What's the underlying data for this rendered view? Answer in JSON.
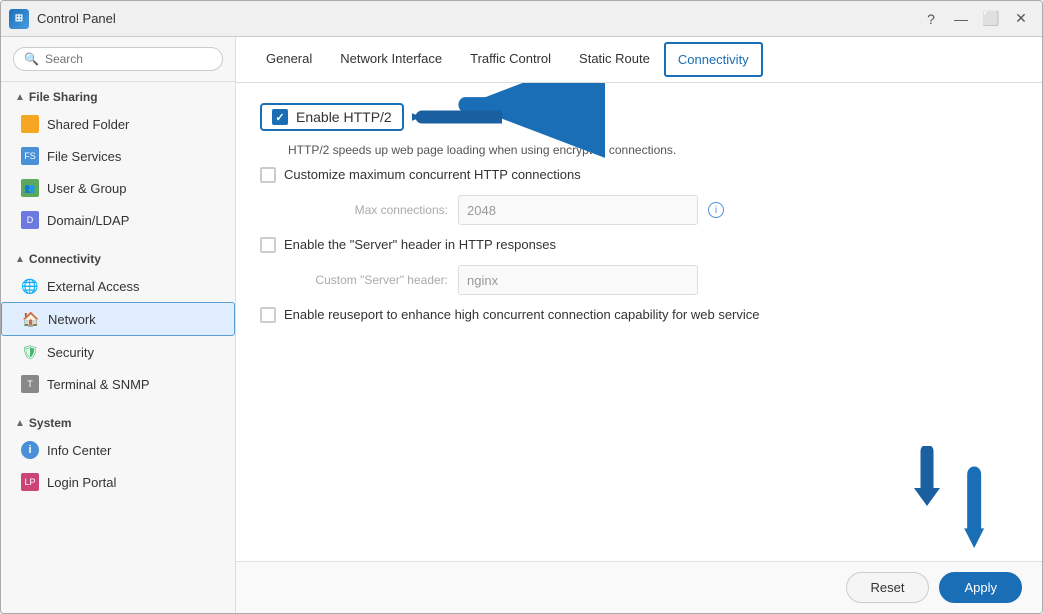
{
  "window": {
    "title": "Control Panel",
    "controls": [
      "?",
      "—",
      "⬜",
      "✕"
    ]
  },
  "sidebar": {
    "search_placeholder": "Search",
    "sections": [
      {
        "name": "file-sharing",
        "label": "File Sharing",
        "expanded": true,
        "items": [
          {
            "id": "shared-folder",
            "label": "Shared Folder",
            "icon": "folder"
          },
          {
            "id": "file-services",
            "label": "File Services",
            "icon": "file"
          },
          {
            "id": "user-group",
            "label": "User & Group",
            "icon": "user"
          },
          {
            "id": "domain-ldap",
            "label": "Domain/LDAP",
            "icon": "domain"
          }
        ]
      },
      {
        "name": "connectivity",
        "label": "Connectivity",
        "expanded": true,
        "items": [
          {
            "id": "external-access",
            "label": "External Access",
            "icon": "globe"
          },
          {
            "id": "network",
            "label": "Network",
            "icon": "network",
            "active": true
          },
          {
            "id": "security",
            "label": "Security",
            "icon": "security"
          },
          {
            "id": "terminal-snmp",
            "label": "Terminal & SNMP",
            "icon": "terminal"
          }
        ]
      },
      {
        "name": "system",
        "label": "System",
        "expanded": true,
        "items": [
          {
            "id": "info-center",
            "label": "Info Center",
            "icon": "info"
          },
          {
            "id": "login-portal",
            "label": "Login Portal",
            "icon": "login"
          }
        ]
      }
    ]
  },
  "tabs": [
    {
      "id": "general",
      "label": "General",
      "active": false
    },
    {
      "id": "network-interface",
      "label": "Network Interface",
      "active": false
    },
    {
      "id": "traffic-control",
      "label": "Traffic Control",
      "active": false
    },
    {
      "id": "static-route",
      "label": "Static Route",
      "active": false
    },
    {
      "id": "connectivity",
      "label": "Connectivity",
      "active": true
    }
  ],
  "settings": {
    "http2": {
      "checkbox_checked": true,
      "label": "Enable HTTP/2",
      "description": "HTTP/2 speeds up web page loading when using encrypted connections."
    },
    "max_connections": {
      "checkbox_checked": false,
      "label": "Customize maximum concurrent HTTP connections",
      "field_label": "Max connections:",
      "field_value": "2048"
    },
    "server_header": {
      "checkbox_checked": false,
      "label": "Enable the \"Server\" header in HTTP responses",
      "field_label": "Custom \"Server\" header:",
      "field_value": "nginx"
    },
    "reuseport": {
      "checkbox_checked": false,
      "label": "Enable reuseport to enhance high concurrent connection capability for web service"
    }
  },
  "footer": {
    "reset_label": "Reset",
    "apply_label": "Apply"
  }
}
